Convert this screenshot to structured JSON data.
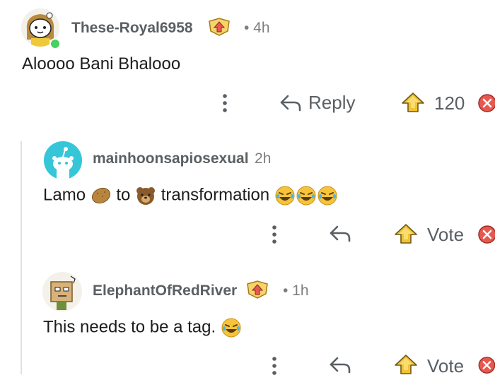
{
  "comments": [
    {
      "username": "These-Royal6958",
      "time": "• 4h",
      "text": "Aloooo Bani Bhalooo",
      "reply_label": "Reply",
      "vote_label": "120",
      "avatar": "female-snoo-avatar-icon",
      "online": true
    },
    {
      "username": "mainhoonsapiosexual",
      "time": "2h",
      "text_parts": [
        "Lamo",
        "to",
        "transformation"
      ],
      "emojis": [
        "potato-emoji",
        "bear-face-emoji",
        "rolling-laughing-emoji"
      ],
      "vote_label": "Vote",
      "avatar": "default-snoo-avatar-icon"
    },
    {
      "username": "ElephantOfRedRiver",
      "time": "• 1h",
      "text": "This needs to be a tag.",
      "vote_label": "Vote",
      "avatar": "box-head-snoo-avatar-icon"
    }
  ],
  "colors": {
    "text": "#1c1c1c",
    "muted": "#5a5f63",
    "upvote_gold": "#f2c230",
    "downvote_red": "#e8584f",
    "default_avatar_bg": "#37c6d8",
    "online_green": "#46d160"
  }
}
